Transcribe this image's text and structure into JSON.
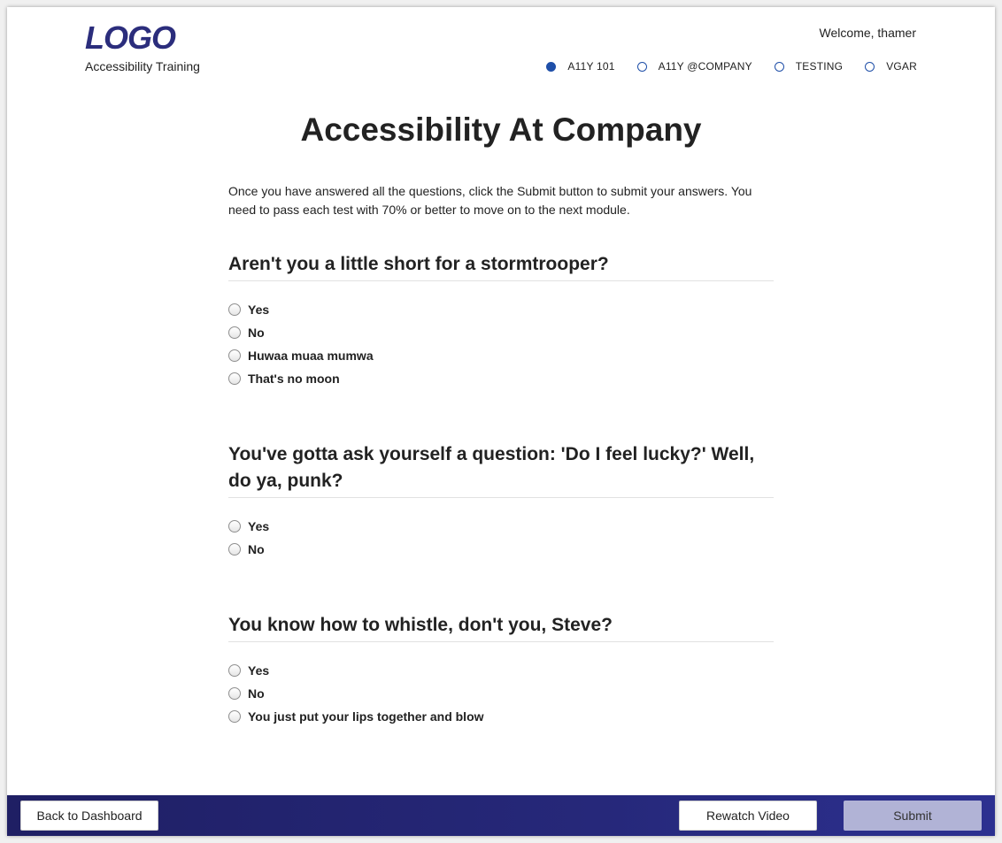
{
  "header": {
    "logo": "LOGO",
    "subtitle": "Accessibility Training",
    "welcome": "Welcome, thamer",
    "steps": [
      {
        "label": "A11Y 101",
        "active": true
      },
      {
        "label": "A11Y @COMPANY",
        "active": false
      },
      {
        "label": "TESTING",
        "active": false
      },
      {
        "label": "VGAR",
        "active": false
      }
    ]
  },
  "main": {
    "title": "Accessibility At Company",
    "intro": "Once you have answered all the questions, click the Submit button to submit your answers. You need to pass each test with 70% or better to move on to the next module.",
    "questions": [
      {
        "title": "Aren't you a little short for a stormtrooper?",
        "options": [
          "Yes",
          "No",
          "Huwaa muaa mumwa",
          "That's no moon"
        ]
      },
      {
        "title": "You've gotta ask yourself a question: 'Do I feel lucky?' Well, do ya, punk?",
        "options": [
          "Yes",
          "No"
        ]
      },
      {
        "title": "You know how to whistle, don't you, Steve?",
        "options": [
          "Yes",
          "No",
          "You just put your lips together and blow"
        ]
      }
    ]
  },
  "footer": {
    "back_label": "Back to Dashboard",
    "rewatch_label": "Rewatch Video",
    "submit_label": "Submit"
  },
  "colors": {
    "brand": "#2b2d7c",
    "step_accent": "#1f4fa8",
    "footer_bg": "#26287a",
    "submit_disabled": "#b1b3d6"
  }
}
